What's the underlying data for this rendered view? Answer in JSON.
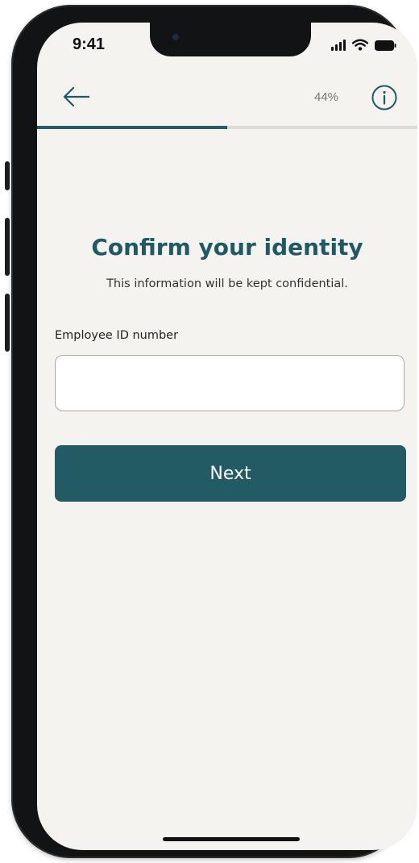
{
  "status_bar": {
    "time": "9:41",
    "icons": [
      "signal-icon",
      "wifi-icon",
      "battery-icon"
    ]
  },
  "header": {
    "back_icon": "arrow-left-icon",
    "progress_label": "44%",
    "progress_fraction": 0.5,
    "info_icon": "info-icon"
  },
  "main": {
    "title": "Confirm your identity",
    "subtitle": "This information will be kept confidential.",
    "employee_id": {
      "label": "Employee ID number",
      "value": "",
      "placeholder": ""
    },
    "next_button_label": "Next"
  },
  "colors": {
    "accent": "#235b65",
    "background": "#f5f3ef",
    "track": "#dddbd7"
  }
}
